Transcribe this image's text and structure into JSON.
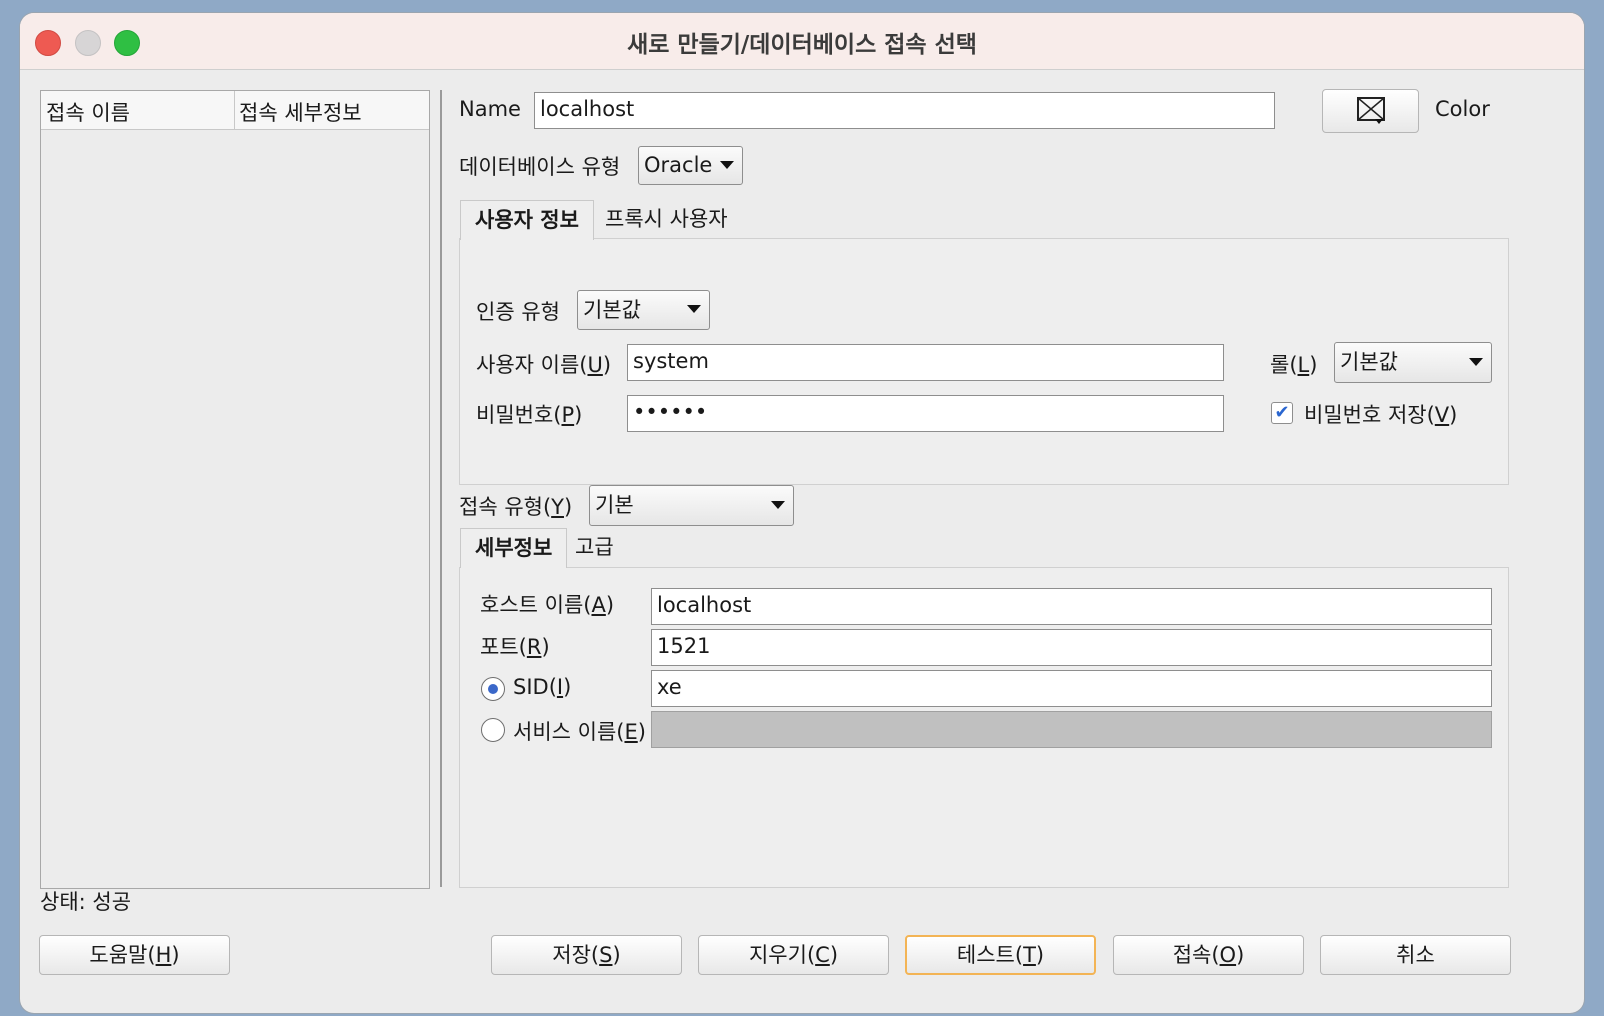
{
  "window": {
    "title": "새로 만들기/데이터베이스 접속 선택"
  },
  "list": {
    "col1": "접속 이름",
    "col2": "접속 세부정보"
  },
  "status": {
    "text": "상태: 성공"
  },
  "name": {
    "label": "Name",
    "value": "localhost"
  },
  "color": {
    "label": "Color"
  },
  "db_type": {
    "label": "데이터베이스 유형",
    "value": "Oracle"
  },
  "tabs_user": {
    "active": "사용자 정보",
    "other": "프록시 사용자"
  },
  "auth": {
    "label": "인증 유형",
    "value": "기본값"
  },
  "username": {
    "label_pre": "사용자 이름(",
    "key": "U",
    "label_post": ")",
    "value": "system"
  },
  "role": {
    "label_pre": "롤(",
    "key": "L",
    "label_post": ")",
    "value": "기본값"
  },
  "password": {
    "label_pre": "비밀번호(",
    "key": "P",
    "label_post": ")",
    "value": "••••••"
  },
  "save_password": {
    "label_pre": "비밀번호 저장(",
    "key": "V",
    "label_post": ")",
    "checked": true
  },
  "conn_type": {
    "label_pre": "접속 유형(",
    "key": "Y",
    "label_post": ")",
    "value": "기본"
  },
  "tabs_detail": {
    "active": "세부정보",
    "other": "고급"
  },
  "host": {
    "label_pre": "호스트 이름(",
    "key": "A",
    "label_post": ")",
    "value": "localhost"
  },
  "port": {
    "label_pre": "포트(",
    "key": "R",
    "label_post": ")",
    "value": "1521"
  },
  "sid": {
    "label_pre": "SID(",
    "key": "I",
    "label_post": ")",
    "value": "xe",
    "selected": true
  },
  "service": {
    "label_pre": "서비스 이름(",
    "key": "E",
    "label_post": ")",
    "value": "",
    "selected": false
  },
  "buttons": {
    "help": {
      "pre": "도움말(",
      "key": "H",
      "post": ")"
    },
    "save": {
      "pre": "저장(",
      "key": "S",
      "post": ")"
    },
    "clear": {
      "pre": "지우기(",
      "key": "C",
      "post": ")"
    },
    "test": {
      "pre": "테스트(",
      "key": "T",
      "post": ")"
    },
    "connect": {
      "pre": "접속(",
      "key": "O",
      "post": ")"
    },
    "cancel": {
      "label": "취소"
    }
  },
  "icons": {
    "color_button": "color-picker-icon",
    "dropdown": "chevron-down-icon",
    "check": "checkmark-icon"
  }
}
